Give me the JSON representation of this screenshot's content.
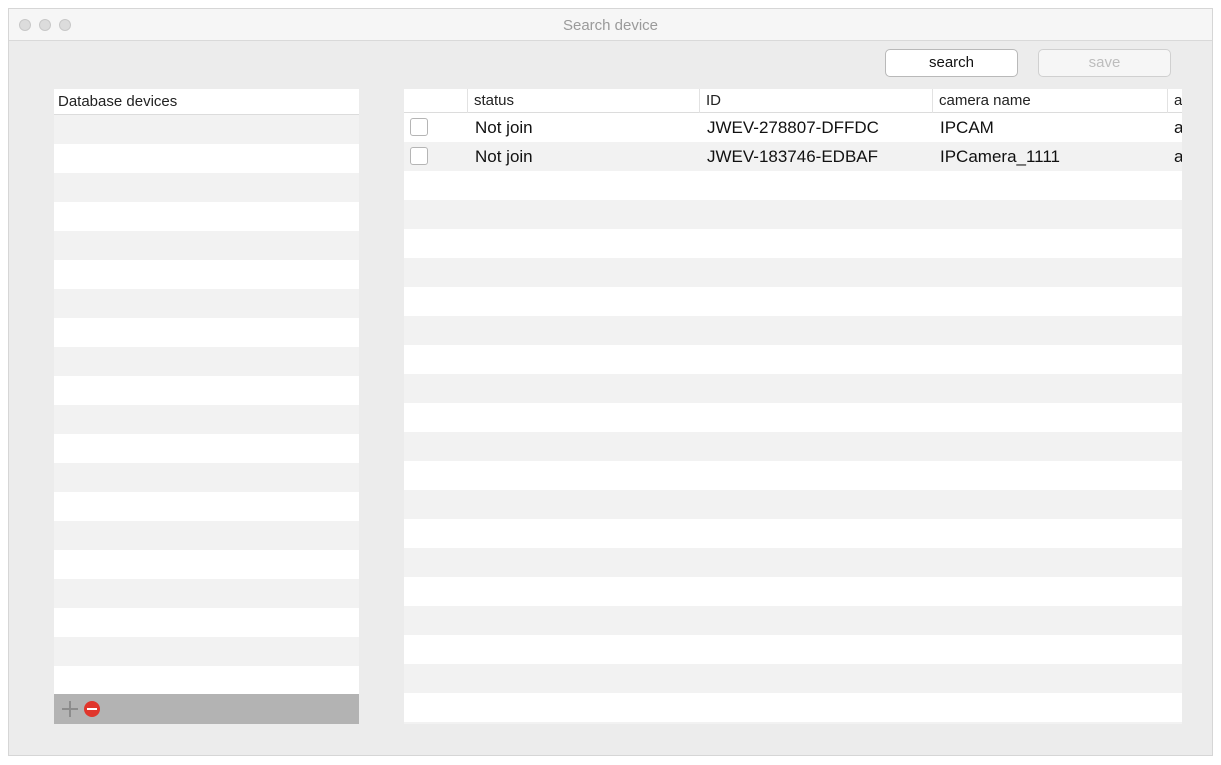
{
  "window": {
    "title": "Search device"
  },
  "toolbar": {
    "search_label": "search",
    "save_label": "save"
  },
  "left_panel": {
    "header": "Database devices",
    "items": []
  },
  "table": {
    "columns": [
      "status",
      "ID",
      "camera name",
      "a"
    ],
    "rows": [
      {
        "checked": false,
        "status": "Not join",
        "id": "JWEV-278807-DFFDC",
        "camera_name": "IPCAM",
        "a": "a"
      },
      {
        "checked": false,
        "status": "Not join",
        "id": "JWEV-183746-EDBAF",
        "camera_name": "IPCamera_1111",
        "a": "a"
      }
    ]
  },
  "colors": {
    "remove_button": "#e0362c",
    "stripe": "#f2f2f2",
    "window_bg": "#ececec"
  },
  "icons": {
    "add": "plus-icon",
    "remove": "minus-circle-icon"
  }
}
